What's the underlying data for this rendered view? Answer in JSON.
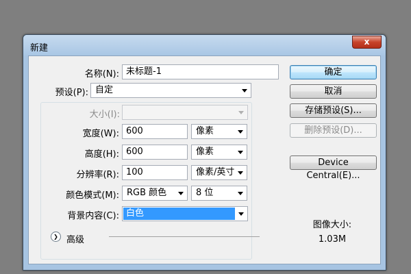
{
  "dialog": {
    "title": "新建",
    "close_label": "x"
  },
  "form": {
    "name": {
      "label": "名称(N):",
      "value": "未标题-1"
    },
    "preset": {
      "label": "预设(P):",
      "value": "自定"
    },
    "size": {
      "label": "大小(I):",
      "value": ""
    },
    "width": {
      "label": "宽度(W):",
      "value": "600",
      "unit": "像素"
    },
    "height": {
      "label": "高度(H):",
      "value": "600",
      "unit": "像素"
    },
    "resolution": {
      "label": "分辨率(R):",
      "value": "100",
      "unit": "像素/英寸"
    },
    "color_mode": {
      "label": "颜色模式(M):",
      "mode": "RGB 颜色",
      "depth": "8 位"
    },
    "background": {
      "label": "背景内容(C):",
      "value": "白色"
    },
    "advanced_label": "高级"
  },
  "buttons": {
    "ok": "确定",
    "cancel": "取消",
    "save_preset": "存储预设(S)...",
    "delete_preset": "删除预设(D)...",
    "device_central": "Device Central(E)..."
  },
  "image_size": {
    "label": "图像大小:",
    "value": "1.03M"
  },
  "icons": {
    "advanced_toggle": "double-chevron-down-icon",
    "dropdown": "caret-down-icon"
  },
  "colors": {
    "selection": "#3399ff",
    "title_bar": "#a9c6e4",
    "close_button": "#c7432a"
  }
}
